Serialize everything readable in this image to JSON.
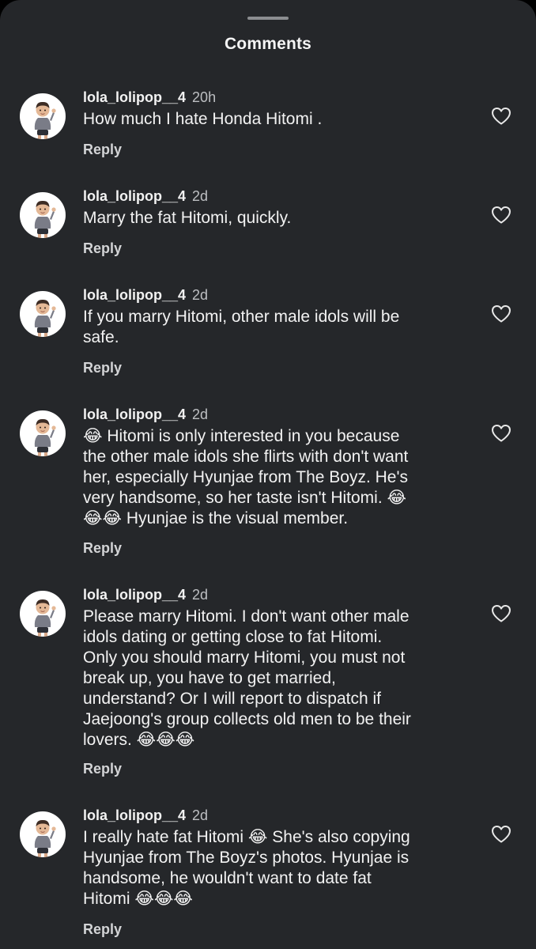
{
  "sheet": {
    "title": "Comments"
  },
  "comments": [
    {
      "username": "lola_lolipop__4",
      "time": "20h",
      "text": "How much I hate Honda Hitomi .",
      "reply_label": "Reply",
      "avatar_icon": "memoji-avatar",
      "like_icon": "heart-outline-icon"
    },
    {
      "username": "lola_lolipop__4",
      "time": "2d",
      "text": "Marry the fat Hitomi, quickly.",
      "reply_label": "Reply",
      "avatar_icon": "memoji-avatar",
      "like_icon": "heart-outline-icon"
    },
    {
      "username": "lola_lolipop__4",
      "time": "2d",
      "text": "If you marry Hitomi, other male idols will be\nsafe.",
      "reply_label": "Reply",
      "avatar_icon": "memoji-avatar",
      "like_icon": "heart-outline-icon"
    },
    {
      "username": "lola_lolipop__4",
      "time": "2d",
      "text": "😂 Hitomi is only interested in you because\nthe other male idols she flirts with don't want\nher, especially Hyunjae from The Boyz. He's\nvery handsome, so her taste isn't Hitomi. 😂\n😂😂 Hyunjae is the visual member.",
      "reply_label": "Reply",
      "avatar_icon": "memoji-avatar",
      "like_icon": "heart-outline-icon"
    },
    {
      "username": "lola_lolipop__4",
      "time": "2d",
      "text": "Please marry Hitomi. I don't want other male\nidols dating or getting close to fat Hitomi.\nOnly you should marry Hitomi, you must not\nbreak up, you have to get married,\nunderstand? Or I will report to dispatch if\nJaejoong's group collects old men to be their\nlovers. 😂😂😂",
      "reply_label": "Reply",
      "avatar_icon": "memoji-avatar",
      "like_icon": "heart-outline-icon"
    },
    {
      "username": "lola_lolipop__4",
      "time": "2d",
      "text": "I really hate fat Hitomi 😂 She's also copying\nHyunjae from The Boyz's photos. Hyunjae is\nhandsome, he wouldn't want to date fat\nHitomi 😂😂😂",
      "reply_label": "Reply",
      "avatar_icon": "memoji-avatar",
      "like_icon": "heart-outline-icon"
    }
  ],
  "colors": {
    "background": "#25272a",
    "text_primary": "#f2f2f2",
    "text_secondary": "#bdbfc2",
    "grabber": "#8b8d90"
  }
}
